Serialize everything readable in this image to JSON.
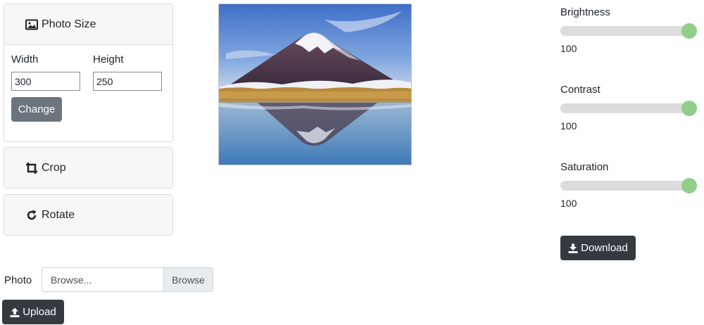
{
  "photo_size": {
    "header": "Photo Size",
    "icon": "image-icon",
    "width_label": "Width",
    "height_label": "Height",
    "width_value": "300",
    "height_value": "250",
    "change_label": "Change"
  },
  "crop": {
    "label": "Crop",
    "icon": "crop-icon"
  },
  "rotate": {
    "label": "Rotate",
    "icon": "rotate-icon"
  },
  "upload": {
    "photo_label": "Photo",
    "placeholder": "Browse...",
    "browse_label": "Browse",
    "upload_label": "Upload",
    "icon": "upload-icon"
  },
  "adjustments": {
    "brightness": {
      "label": "Brightness",
      "value": "100",
      "fraction": 1.0
    },
    "contrast": {
      "label": "Contrast",
      "value": "100",
      "fraction": 1.0
    },
    "saturation": {
      "label": "Saturation",
      "value": "100",
      "fraction": 1.0
    }
  },
  "download": {
    "label": "Download",
    "icon": "download-icon"
  },
  "colors": {
    "slider_thumb": "#8fcf8a",
    "dark_button": "#343a40",
    "gray_button": "#6c757d"
  }
}
